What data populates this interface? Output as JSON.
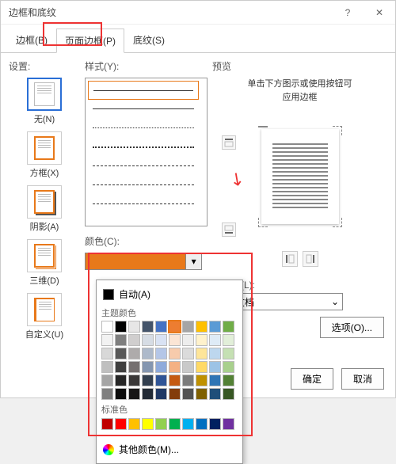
{
  "dialog": {
    "title": "边框和底纹"
  },
  "tabs": {
    "border": "边框(B)",
    "page_border": "页面边框(P)",
    "shading": "底纹(S)"
  },
  "labels": {
    "settings": "设置:",
    "style": "样式(Y):",
    "color": "颜色(C):",
    "preview": "预览",
    "apply_to": "应用于(L):",
    "options": "选项(O)...",
    "ok": "确定",
    "cancel": "取消"
  },
  "settings": {
    "none": "无(N)",
    "box": "方框(X)",
    "shadow": "阴影(A)",
    "three_d": "三维(D)",
    "custom": "自定义(U)"
  },
  "preview": {
    "hint1": "单击下方图示或使用按钮可",
    "hint2": "应用边框"
  },
  "apply": {
    "value": "整篇文档"
  },
  "colorpicker": {
    "auto": "自动(A)",
    "theme": "主题颜色",
    "standard": "标准色",
    "more": "其他颜色(M)...",
    "theme_row": [
      "#ffffff",
      "#000000",
      "#e7e6e6",
      "#44546a",
      "#4472c4",
      "#ed7d31",
      "#a5a5a5",
      "#ffc000",
      "#5b9bd5",
      "#70ad47"
    ],
    "shades": [
      [
        "#f2f2f2",
        "#7f7f7f",
        "#d0cece",
        "#d6dce4",
        "#d9e2f3",
        "#fbe5d5",
        "#ededed",
        "#fff2cc",
        "#deebf6",
        "#e2efd9"
      ],
      [
        "#d8d8d8",
        "#595959",
        "#aeabab",
        "#adb9ca",
        "#b4c6e7",
        "#f7cbac",
        "#dbdbdb",
        "#fee599",
        "#bdd7ee",
        "#c5e0b3"
      ],
      [
        "#bfbfbf",
        "#3f3f3f",
        "#757070",
        "#8496b0",
        "#8eaadb",
        "#f4b183",
        "#c9c9c9",
        "#ffd965",
        "#9cc3e5",
        "#a8d08d"
      ],
      [
        "#a5a5a5",
        "#262626",
        "#3a3838",
        "#323f4f",
        "#2f5496",
        "#c55a11",
        "#7b7b7b",
        "#bf9000",
        "#2e75b5",
        "#538135"
      ],
      [
        "#7f7f7f",
        "#0c0c0c",
        "#171616",
        "#222a35",
        "#1f3864",
        "#833c0b",
        "#525252",
        "#7f6000",
        "#1e4e79",
        "#375623"
      ]
    ],
    "standard_row": [
      "#c00000",
      "#ff0000",
      "#ffc000",
      "#ffff00",
      "#92d050",
      "#00b050",
      "#00b0f0",
      "#0070c0",
      "#002060",
      "#7030a0"
    ]
  }
}
